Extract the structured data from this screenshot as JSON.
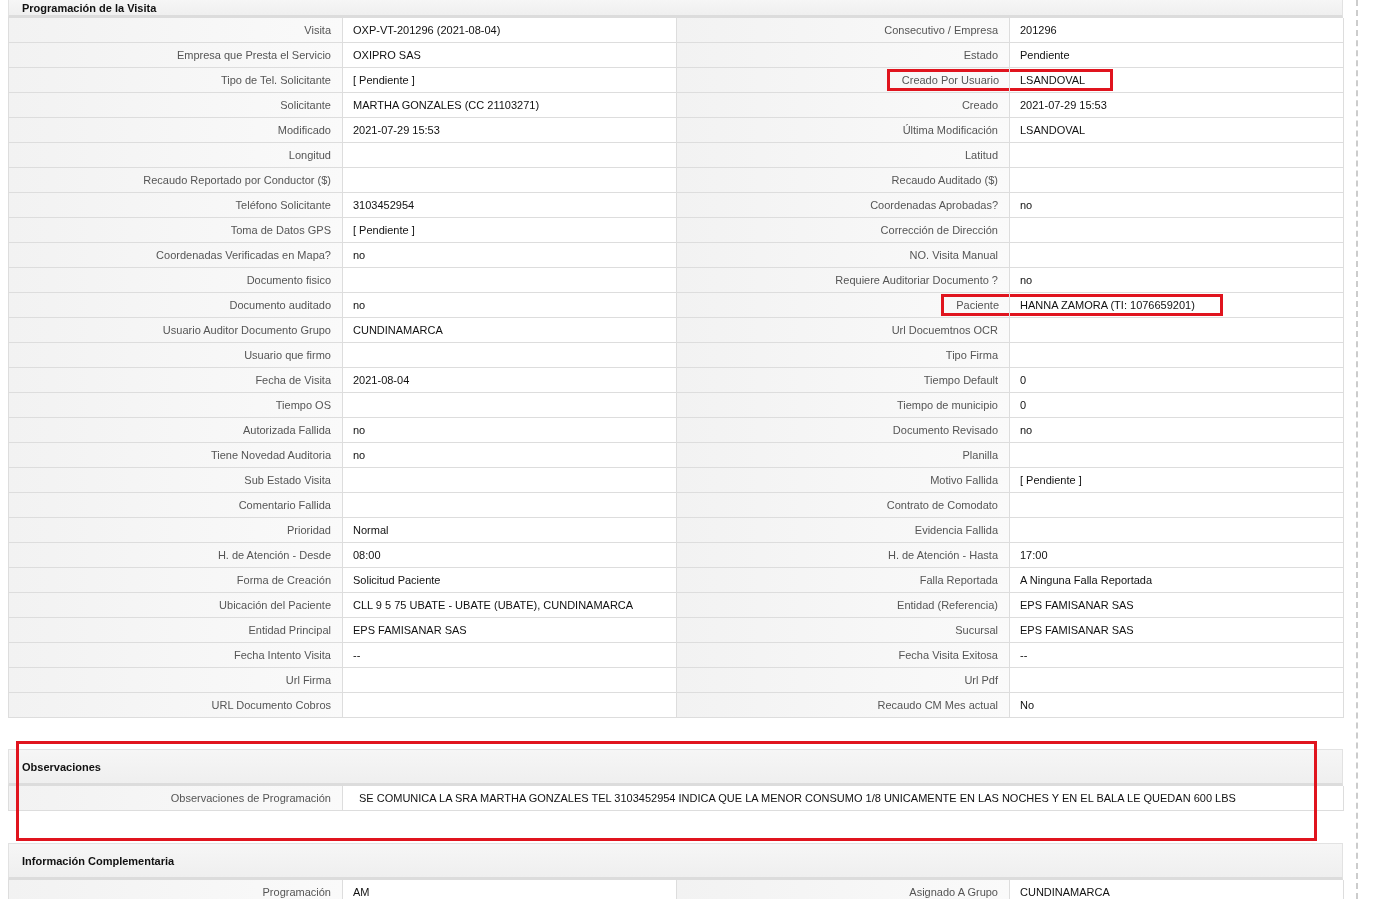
{
  "sections": [
    {
      "title": "Programación de la Visita",
      "highlighted": false,
      "rows": [
        {
          "fields": [
            {
              "label": "Visita",
              "value": "OXP-VT-201296 (2021-08-04)",
              "highlighted": false
            },
            {
              "label": "Consecutivo / Empresa",
              "value": "201296",
              "highlighted": false
            }
          ]
        },
        {
          "fields": [
            {
              "label": "Empresa que Presta el Servicio",
              "value": "OXIPRO SAS",
              "highlighted": false
            },
            {
              "label": "Estado",
              "value": "Pendiente",
              "highlighted": false
            }
          ]
        },
        {
          "fields": [
            {
              "label": "Tipo de Tel. Solicitante",
              "value": "[ Pendiente ]",
              "highlighted": false
            },
            {
              "label": "Creado Por Usuario",
              "value": "LSANDOVAL",
              "highlighted": true
            }
          ]
        },
        {
          "fields": [
            {
              "label": "Solicitante",
              "value": "MARTHA GONZALES (CC 21103271)",
              "highlighted": false
            },
            {
              "label": "Creado",
              "value": "2021-07-29 15:53",
              "highlighted": false
            }
          ]
        },
        {
          "fields": [
            {
              "label": "Modificado",
              "value": "2021-07-29 15:53",
              "highlighted": false
            },
            {
              "label": "Última Modificación",
              "value": "LSANDOVAL",
              "highlighted": false
            }
          ]
        },
        {
          "fields": [
            {
              "label": "Longitud",
              "highlighted": false
            },
            {
              "label": "Latitud",
              "highlighted": false
            }
          ]
        },
        {
          "fields": [
            {
              "label": "Recaudo Reportado por Conductor ($)",
              "highlighted": false
            },
            {
              "label": "Recaudo Auditado ($)",
              "highlighted": false
            }
          ]
        },
        {
          "fields": [
            {
              "label": "Teléfono Solicitante",
              "value": "3103452954",
              "highlighted": false
            },
            {
              "label": "Coordenadas Aprobadas?",
              "value": "no",
              "highlighted": false
            }
          ]
        },
        {
          "fields": [
            {
              "label": "Toma de Datos GPS",
              "value": "[ Pendiente ]",
              "highlighted": false
            },
            {
              "label": "Corrección de Dirección",
              "highlighted": false
            }
          ]
        },
        {
          "fields": [
            {
              "label": "Coordenadas Verificadas en Mapa?",
              "value": "no",
              "highlighted": false
            },
            {
              "label": "NO. Visita Manual",
              "highlighted": false
            }
          ]
        },
        {
          "fields": [
            {
              "label": "Documento fisico",
              "highlighted": false
            },
            {
              "label": "Requiere Auditoriar Documento ?",
              "value": "no",
              "highlighted": false
            }
          ]
        },
        {
          "fields": [
            {
              "label": "Documento auditado",
              "value": "no",
              "highlighted": false
            },
            {
              "label": "Paciente",
              "value": "HANNA ZAMORA (TI: 1076659201)",
              "highlighted": true
            }
          ]
        },
        {
          "fields": [
            {
              "label": "Usuario Auditor Documento Grupo",
              "value": "CUNDINAMARCA",
              "highlighted": false
            },
            {
              "label": "Url Docuemtnos OCR",
              "highlighted": false
            }
          ]
        },
        {
          "fields": [
            {
              "label": "Usuario que firmo",
              "highlighted": false
            },
            {
              "label": "Tipo Firma",
              "highlighted": false
            }
          ]
        },
        {
          "fields": [
            {
              "label": "Fecha de Visita",
              "value": "2021-08-04",
              "highlighted": false
            },
            {
              "label": "Tiempo Default",
              "value": "0",
              "highlighted": false
            }
          ]
        },
        {
          "fields": [
            {
              "label": "Tiempo OS",
              "highlighted": false
            },
            {
              "label": "Tiempo de municipio",
              "value": "0",
              "highlighted": false
            }
          ]
        },
        {
          "fields": [
            {
              "label": "Autorizada Fallida",
              "value": "no",
              "highlighted": false
            },
            {
              "label": "Documento Revisado",
              "value": "no",
              "highlighted": false
            }
          ]
        },
        {
          "fields": [
            {
              "label": "Tiene Novedad Auditoria",
              "value": "no",
              "highlighted": false
            },
            {
              "label": "Planilla",
              "highlighted": false
            }
          ]
        },
        {
          "fields": [
            {
              "label": "Sub Estado Visita",
              "highlighted": false
            },
            {
              "label": "Motivo Fallida",
              "value": "[ Pendiente ]",
              "highlighted": false
            }
          ]
        },
        {
          "fields": [
            {
              "label": "Comentario Fallida",
              "highlighted": false
            },
            {
              "label": "Contrato de Comodato",
              "highlighted": false
            }
          ]
        },
        {
          "fields": [
            {
              "label": "Prioridad",
              "value": "Normal",
              "highlighted": false
            },
            {
              "label": "Evidencia Fallida",
              "highlighted": false
            }
          ]
        },
        {
          "fields": [
            {
              "label": "H. de Atención - Desde",
              "value": "08:00",
              "highlighted": false
            },
            {
              "label": "H. de Atención - Hasta",
              "value": "17:00",
              "highlighted": false
            }
          ]
        },
        {
          "fields": [
            {
              "label": "Forma de Creación",
              "value": "Solicitud Paciente",
              "highlighted": false
            },
            {
              "label": "Falla Reportada",
              "value": "A Ninguna Falla Reportada",
              "highlighted": false
            }
          ]
        },
        {
          "fields": [
            {
              "label": "Ubicación del Paciente",
              "value": "CLL 9 5 75 UBATE - UBATE (UBATE), CUNDINAMARCA",
              "highlighted": false
            },
            {
              "label": "Entidad (Referencia)",
              "value": "EPS FAMISANAR SAS",
              "highlighted": false
            }
          ]
        },
        {
          "fields": [
            {
              "label": "Entidad Principal",
              "value": "EPS FAMISANAR SAS",
              "highlighted": false
            },
            {
              "label": "Sucursal",
              "value": "EPS FAMISANAR SAS",
              "highlighted": false
            }
          ]
        },
        {
          "fields": [
            {
              "label": "Fecha Intento Visita",
              "value": "--",
              "highlighted": false
            },
            {
              "label": "Fecha Visita Exitosa",
              "value": "--",
              "highlighted": false
            }
          ]
        },
        {
          "fields": [
            {
              "label": "Url Firma",
              "highlighted": false
            },
            {
              "label": "Url Pdf",
              "highlighted": false
            }
          ]
        },
        {
          "fields": [
            {
              "label": "URL Documento Cobros",
              "highlighted": false
            },
            {
              "label": "Recaudo CM Mes actual",
              "value": "No",
              "highlighted": false
            }
          ]
        }
      ]
    },
    {
      "title": "Observaciones",
      "highlighted": true,
      "rows": [
        {
          "fields": [
            {
              "label": "Observaciones de Programación",
              "value": "SE COMUNICA LA SRA MARTHA GONZALES TEL 3103452954 INDICA QUE LA MENOR CONSUMO 1/8 UNICAMENTE EN LAS NOCHES Y EN EL BALA LE QUEDAN 600 LBS",
              "highlighted": false
            }
          ]
        }
      ]
    },
    {
      "title": "Información Complementaria",
      "highlighted": false,
      "rows": [
        {
          "fields": [
            {
              "label": "Programación",
              "value": "AM",
              "highlighted": false
            },
            {
              "label": "Asignado A Grupo",
              "value": "CUNDINAMARCA",
              "highlighted": false
            }
          ]
        }
      ]
    }
  ]
}
